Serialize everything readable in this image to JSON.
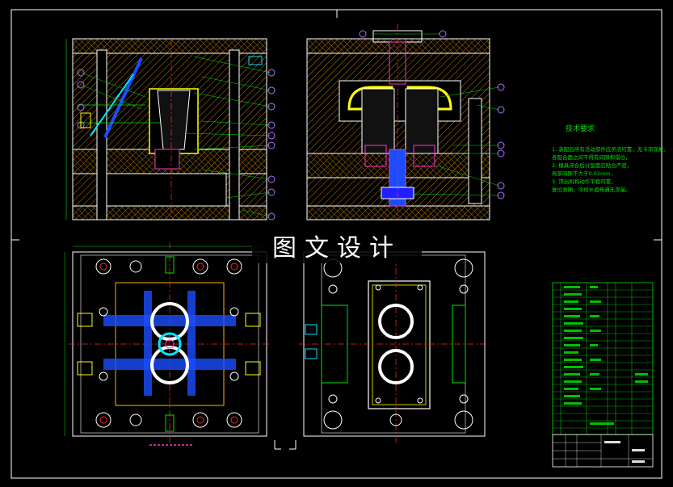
{
  "watermark": "图文设计",
  "technical_requirements": {
    "title": "技术要求",
    "lines": [
      "1. 装配后所有活动部件应灵活可靠，无卡滞现象，",
      "各配合面之间不得有间隙和错位，",
      "2. 模具闭合后分型面应贴合严密，",
      "局部间隙不大于0.02mm，",
      "3. 顶出机构动作平稳可靠，",
      "复位准确，冷却水道畅通无渗漏。"
    ]
  },
  "colors": {
    "outline": "#ffffff",
    "hatch": "#ffb000",
    "green": "#00e000",
    "cyan": "#00e5ff",
    "magenta": "#ff2fd0",
    "red": "#ff2020",
    "blue": "#1a4dff",
    "yellow": "#ffff00",
    "balloon": "#b070ff"
  }
}
